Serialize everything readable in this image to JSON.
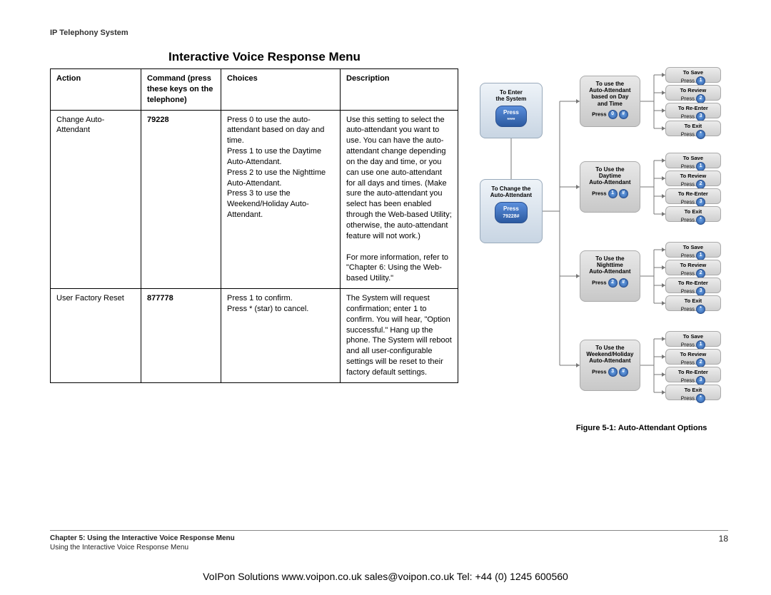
{
  "header": "IP Telephony System",
  "title": "Interactive Voice Response Menu",
  "table": {
    "headers": [
      "Action",
      "Command (press these keys on the telephone)",
      "Choices",
      "Description"
    ],
    "rows": [
      {
        "action": "Change Auto-Attendant",
        "command": "79228",
        "choices": "Press 0 to use the auto-attendant based on day and time.\nPress 1 to use the Daytime Auto-Attendant.\nPress 2 to use the Nighttime Auto-Attendant.\nPress 3 to use the Weekend/Holiday Auto-Attendant.",
        "description": "Use this setting to select the auto-attendant you want to use. You can have the auto-attendant change depending on the day and time, or you can use one auto-attendant for all days and times. (Make sure the auto-attendant you select has been enabled through the Web-based Utility; otherwise, the auto-attendant feature will not work.)\n\nFor more information, refer to \"Chapter 6: Using the Web-based Utility.\""
      },
      {
        "action": "User Factory Reset",
        "command": "877778",
        "choices": "Press 1 to confirm.\nPress * (star) to cancel.",
        "description": "The System will request confirmation; enter 1 to confirm. You will hear, \"Option successful.\" Hang up the phone. The System will reboot and all user-configurable settings will be reset to their factory default settings."
      }
    ]
  },
  "diagram": {
    "enter": {
      "title": "To Enter\nthe System",
      "btn": "Press",
      "sub": "****"
    },
    "change": {
      "title": "To Change the\nAuto-Attendant",
      "btn": "Press",
      "sub": "79228#"
    },
    "mid": [
      {
        "title": "To use the\nAuto-Attendant\nbased on Day\nand Time",
        "press": "Press",
        "nums": [
          "0",
          "#"
        ]
      },
      {
        "title": "To Use the\nDaytime\nAuto-Attendant",
        "press": "Press",
        "nums": [
          "1",
          "#"
        ]
      },
      {
        "title": "To Use the\nNighttime\nAuto-Attendant",
        "press": "Press",
        "nums": [
          "2",
          "#"
        ]
      },
      {
        "title": "To Use the\nWeekend/Holiday\nAuto-Attendant",
        "press": "Press",
        "nums": [
          "3",
          "#"
        ]
      }
    ],
    "leafLabels": [
      "To Save",
      "To Review",
      "To Re-Enter",
      "To Exit"
    ],
    "leafNums": [
      "1",
      "2",
      "3",
      "*"
    ],
    "leafPress": "Press"
  },
  "figureCaption": "Figure 5-1: Auto-Attendant Options",
  "footer": {
    "chapter": "Chapter 5: Using the Interactive Voice Response Menu",
    "sub": "Using the Interactive Voice Response Menu",
    "page": "18"
  },
  "bottom": "VoIPon Solutions  www.voipon.co.uk  sales@voipon.co.uk  Tel: +44 (0) 1245 600560"
}
